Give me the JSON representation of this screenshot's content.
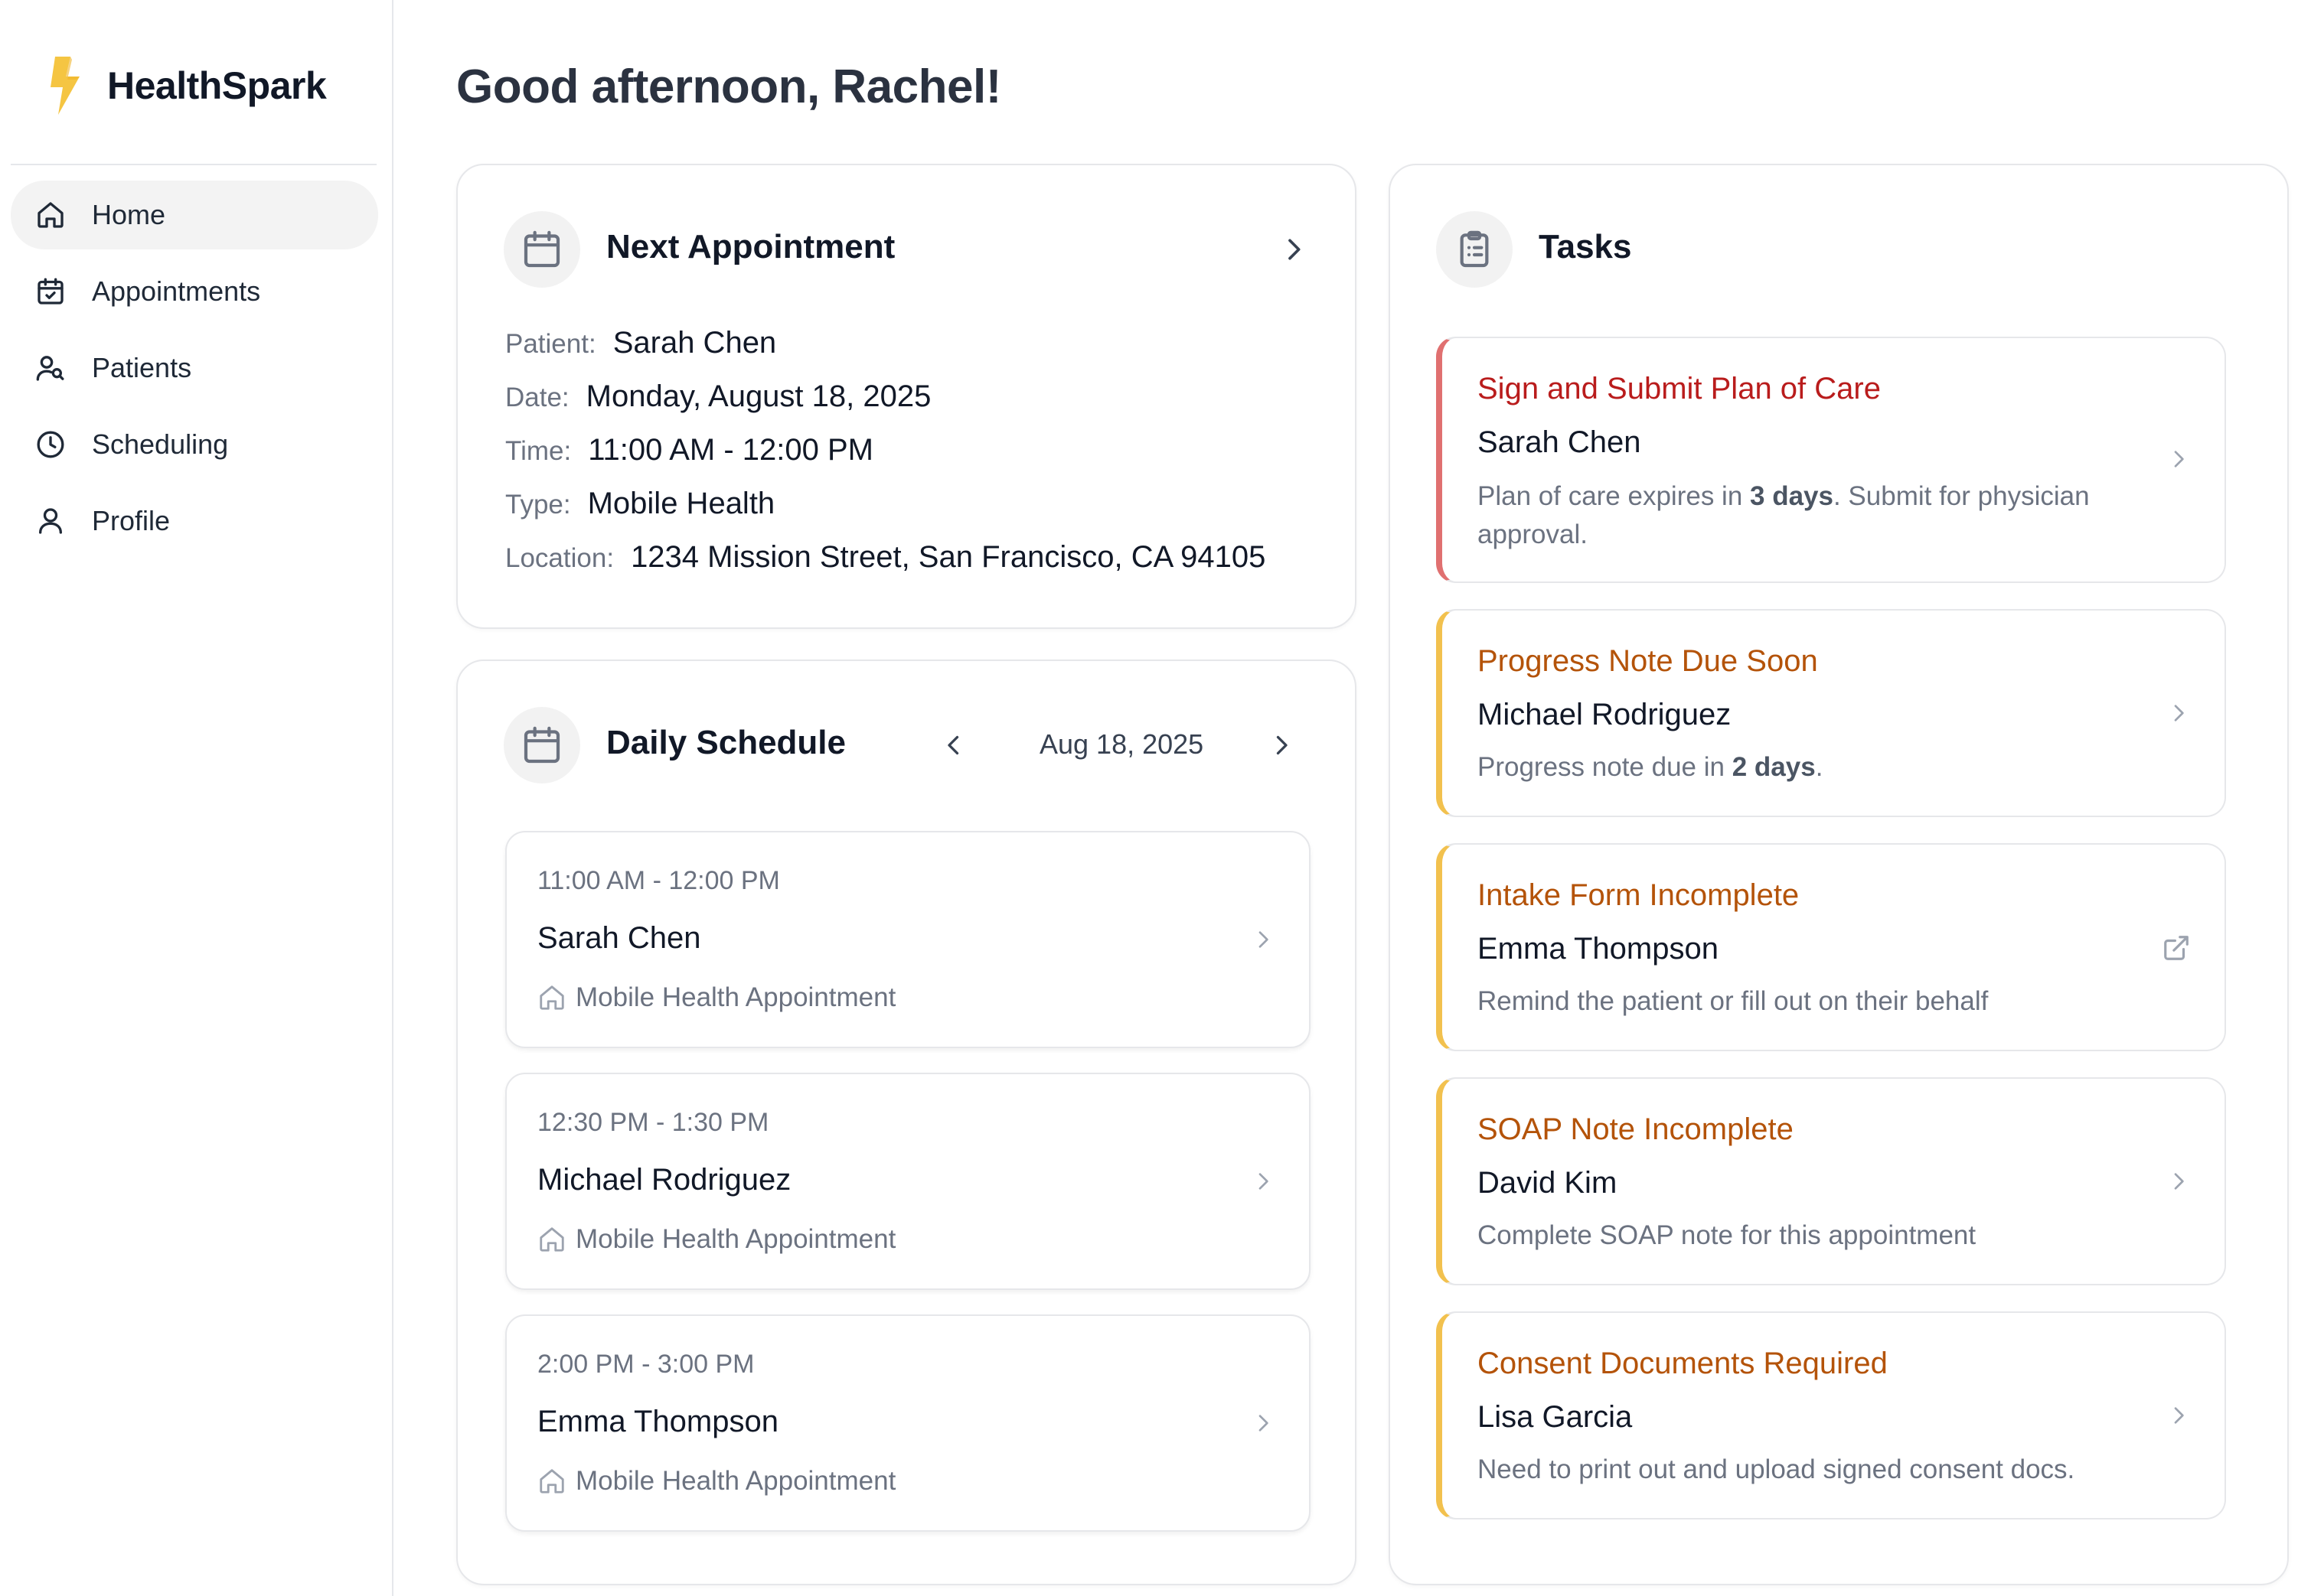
{
  "app": {
    "name": "HealthSpark",
    "accent": "#f5c542"
  },
  "sidebar": {
    "items": [
      {
        "label": "Home",
        "icon": "home-icon",
        "active": true
      },
      {
        "label": "Appointments",
        "icon": "calendar-check-icon"
      },
      {
        "label": "Patients",
        "icon": "patients-icon"
      },
      {
        "label": "Scheduling",
        "icon": "clock-icon"
      },
      {
        "label": "Profile",
        "icon": "user-icon"
      }
    ]
  },
  "greeting": "Good afternoon, Rachel!",
  "next_appointment": {
    "title": "Next Appointment",
    "patient_label": "Patient:",
    "patient": "Sarah Chen",
    "date_label": "Date:",
    "date": "Monday, August 18, 2025",
    "time_label": "Time:",
    "time": "11:00 AM - 12:00 PM",
    "type_label": "Type:",
    "type": "Mobile Health",
    "location_label": "Location:",
    "location": "1234 Mission Street, San Francisco, CA 94105"
  },
  "daily_schedule": {
    "title": "Daily Schedule",
    "date": "Aug 18, 2025",
    "slots": [
      {
        "time": "11:00 AM - 12:00 PM",
        "name": "Sarah Chen",
        "type": "Mobile Health Appointment"
      },
      {
        "time": "12:30 PM - 1:30 PM",
        "name": "Michael Rodriguez",
        "type": "Mobile Health Appointment"
      },
      {
        "time": "2:00 PM - 3:00 PM",
        "name": "Emma Thompson",
        "type": "Mobile Health Appointment"
      }
    ]
  },
  "tasks": {
    "title": "Tasks",
    "colors": {
      "urgent": "#b91c1c",
      "warning": "#b45309",
      "urgent_border": "#e07070",
      "warning_border": "#f2c14e"
    },
    "items": [
      {
        "title": "Sign and Submit Plan of Care",
        "name": "Sarah Chen",
        "desc_before": "Plan of care expires in ",
        "desc_bold": "3 days",
        "desc_after": ". Submit for physician approval."
      },
      {
        "title": "Progress Note Due Soon",
        "name": "Michael Rodriguez",
        "desc_before": "Progress note due in ",
        "desc_bold": "2 days",
        "desc_after": "."
      },
      {
        "title": "Intake Form Incomplete",
        "name": "Emma Thompson",
        "desc": "Remind the patient or fill out on their behalf"
      },
      {
        "title": "SOAP Note Incomplete",
        "name": "David Kim",
        "desc": "Complete SOAP note for this appointment"
      },
      {
        "title": "Consent Documents Required",
        "name": "Lisa Garcia",
        "desc": "Need to print out and upload signed consent docs."
      }
    ]
  }
}
